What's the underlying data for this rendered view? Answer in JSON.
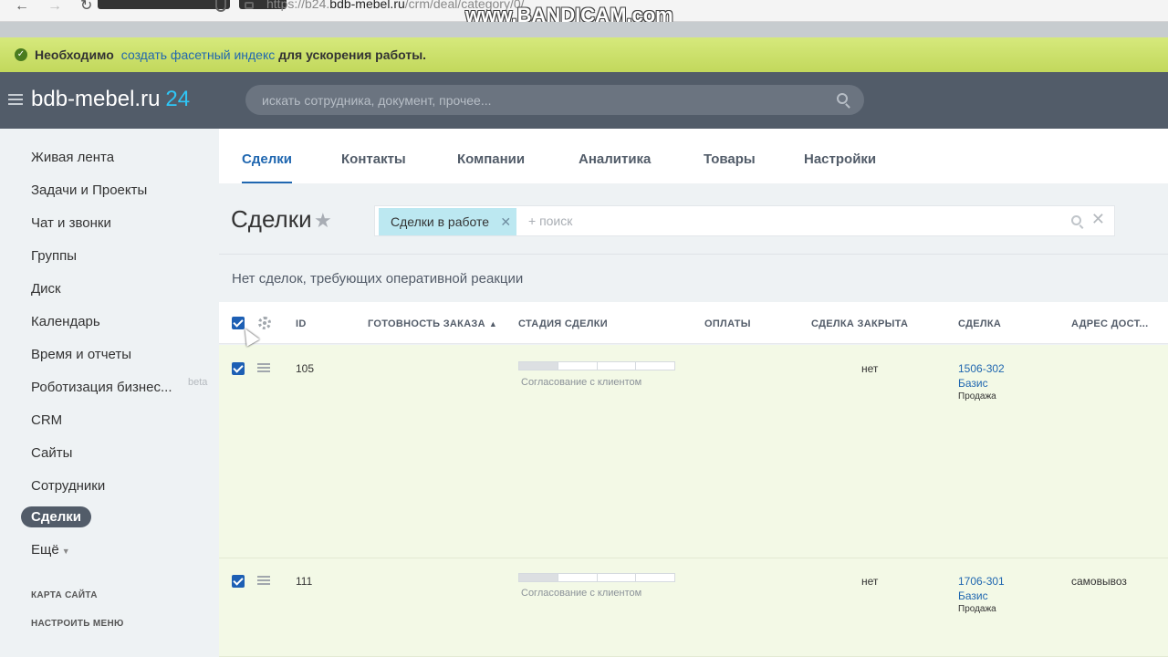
{
  "browser": {
    "url_prefix": "https://b24.",
    "url_host": "bdb-mebel.ru",
    "url_path": "/crm/deal/category/0/"
  },
  "watermark": "www.BANDICAM.com",
  "notice": {
    "strong_prefix": "Необходимо",
    "link": "создать фасетный индекс",
    "strong_suffix": "для ускорения работы."
  },
  "header": {
    "logo_text": "bdb-mebel.ru",
    "logo_number": "24",
    "search_placeholder": "искать сотрудника, документ, прочее..."
  },
  "sidebar": {
    "items": [
      {
        "label": "Живая лента"
      },
      {
        "label": "Задачи и Проекты"
      },
      {
        "label": "Чат и звонки"
      },
      {
        "label": "Группы"
      },
      {
        "label": "Диск"
      },
      {
        "label": "Календарь"
      },
      {
        "label": "Время и отчеты"
      },
      {
        "label": "Роботизация бизнес..."
      },
      {
        "label": "CRM"
      },
      {
        "label": "Сайты"
      },
      {
        "label": "Сотрудники"
      },
      {
        "label": "Сделки"
      },
      {
        "label": "Ещё"
      }
    ],
    "beta_label": "beta",
    "site_map": "КАРТА САЙТА",
    "configure_menu": "НАСТРОИТЬ МЕНЮ"
  },
  "tabs": [
    {
      "label": "Сделки"
    },
    {
      "label": "Контакты"
    },
    {
      "label": "Компании"
    },
    {
      "label": "Аналитика"
    },
    {
      "label": "Товары"
    },
    {
      "label": "Настройки"
    }
  ],
  "page": {
    "title": "Сделки",
    "filter_chip": "Сделки в работе",
    "filter_placeholder": "+ поиск",
    "reaction_text": "Нет сделок, требующих оперативной реакции"
  },
  "table": {
    "columns": [
      "ID",
      "ГОТОВНОСТЬ ЗАКАЗА",
      "СТАДИЯ СДЕЛКИ",
      "ОПЛАТЫ",
      "СДЕЛКА ЗАКРЫТА",
      "СДЕЛКА",
      "АДРЕС ДОСТ..."
    ],
    "rows": [
      {
        "id": "105",
        "stage": "Согласование с клиентом",
        "stage_progress": 0.25,
        "closed": "нет",
        "deal_code": "1506-302",
        "deal_name": "Базис",
        "deal_type": "Продажа",
        "address": ""
      },
      {
        "id": "111",
        "stage": "Согласование с клиентом",
        "stage_progress": 0.25,
        "closed": "нет",
        "deal_code": "1706-301",
        "deal_name": "Базис",
        "deal_type": "Продажа",
        "address": "самовывоз"
      }
    ]
  },
  "colors": {
    "accent": "#2067b0",
    "header_bg": "#525c69",
    "notice_bg": "#c9de68",
    "row_bg": "#f3f9e6",
    "logo_number": "#2fc6f6"
  }
}
